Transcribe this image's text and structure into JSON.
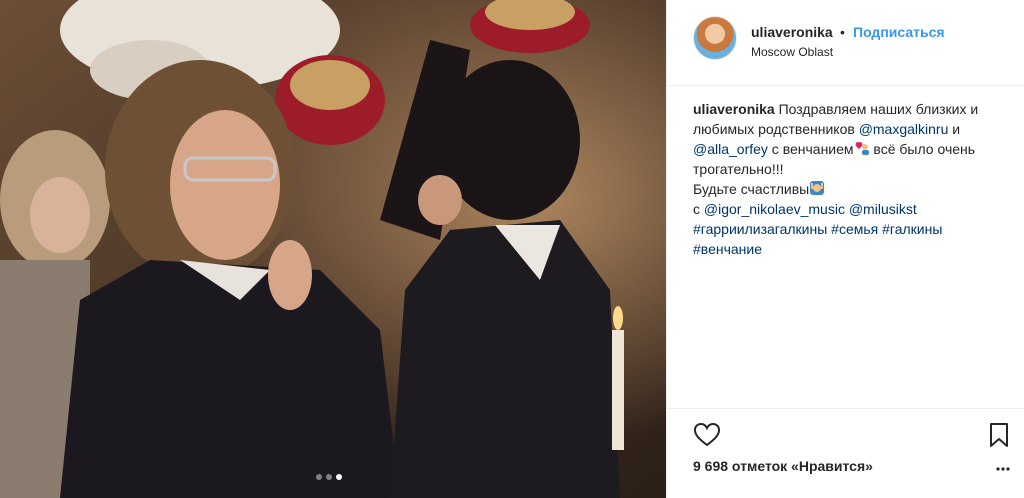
{
  "post": {
    "username": "uliaveronika",
    "separator": "•",
    "follow_label": "Подписаться",
    "location": "Moscow Oblast",
    "carousel": {
      "count": 3,
      "active_index": 2
    }
  },
  "caption": {
    "username": "uliaveronika",
    "text_1": " Поздравляем наших близких и любимых родственников ",
    "mention_1": "@maxgalkinru",
    "text_2": " и ",
    "mention_2": "@alla_orfey",
    "text_3": " с венчанием",
    "text_4": " всё было очень трогательно!!!",
    "text_5": "Будьте счастливы",
    "text_6": "с ",
    "mention_3": "@igor_nikolaev_music",
    "text_7": " ",
    "mention_4": "@milusikst",
    "hashtags_line1": "#гарриилизагалкины #семья #галкины",
    "hashtags_line2": "#венчание",
    "emoji_1": "heart-couple-emoji",
    "emoji_2": "cheering-emoji"
  },
  "actions": {
    "likes_text": "9 698 отметок «Нравится»",
    "like_icon": "heart-icon",
    "save_icon": "bookmark-icon",
    "more_icon": "more-icon"
  },
  "colors": {
    "link": "#003569",
    "follow": "#3897f0",
    "text": "#262626",
    "border": "#efefef"
  }
}
